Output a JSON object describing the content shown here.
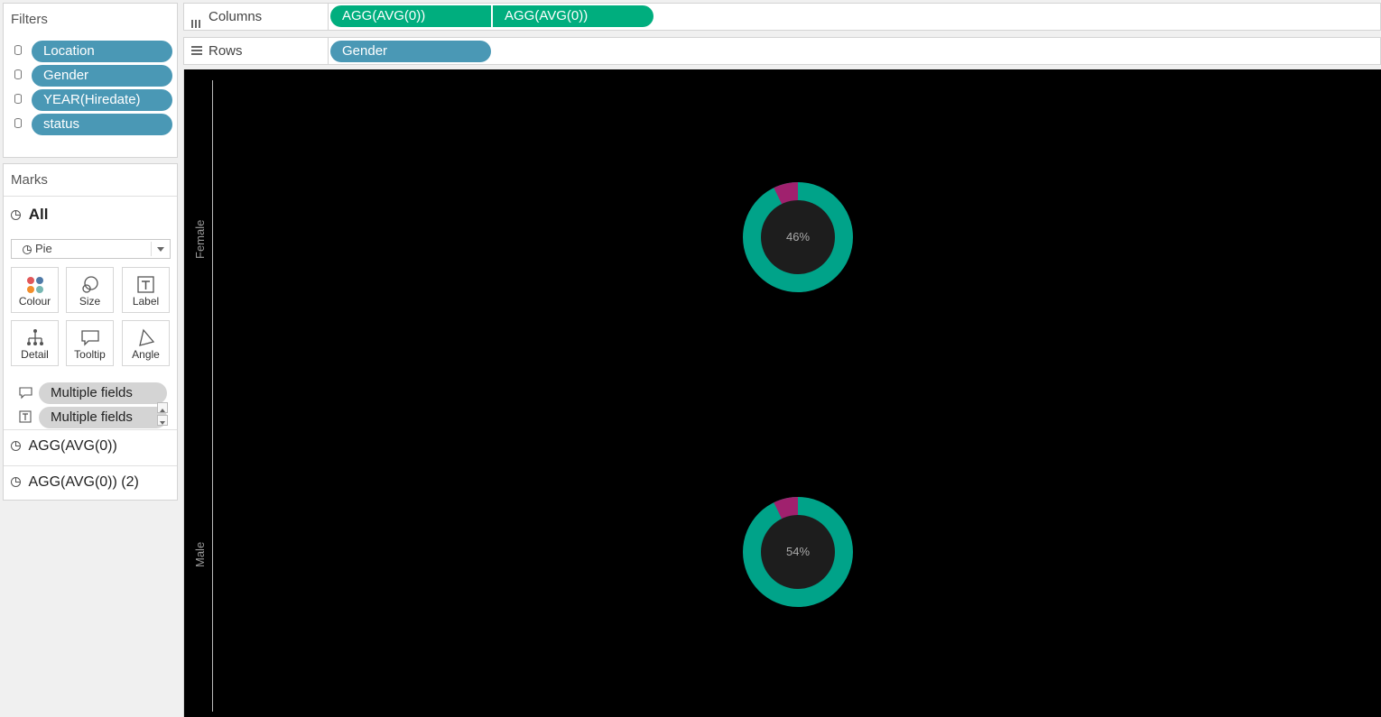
{
  "colors": {
    "pill_blue": "#4a98b5",
    "pill_green": "#00ae7e",
    "donut_main": "#00a389",
    "donut_minor": "#a0216e",
    "donut_center": "#1d1d1d",
    "viz_bg": "#000000"
  },
  "filters": {
    "title": "Filters",
    "items": [
      "Location",
      "Gender",
      "YEAR(Hiredate)",
      "status"
    ]
  },
  "marks": {
    "title": "Marks",
    "all_label": "All",
    "mark_type": "Pie",
    "buttons": [
      "Colour",
      "Size",
      "Label",
      "Detail",
      "Tooltip",
      "Angle"
    ],
    "fields": [
      "Multiple fields",
      "Multiple fields"
    ],
    "measures": [
      "AGG(AVG(0))",
      "AGG(AVG(0)) (2)"
    ]
  },
  "shelves": {
    "columns_label": "Columns",
    "columns_pills": [
      "AGG(AVG(0))",
      "AGG(AVG(0))"
    ],
    "rows_label": "Rows",
    "rows_pills": [
      "Gender"
    ]
  },
  "viz": {
    "rows": [
      {
        "header": "Female",
        "value": 46,
        "label": "46%"
      },
      {
        "header": "Male",
        "value": 54,
        "label": "54%"
      }
    ]
  },
  "chart_data": {
    "type": "pie",
    "categories": [
      "Female",
      "Male"
    ],
    "values": [
      46,
      54
    ],
    "data_labels": [
      "46%",
      "54%"
    ]
  }
}
